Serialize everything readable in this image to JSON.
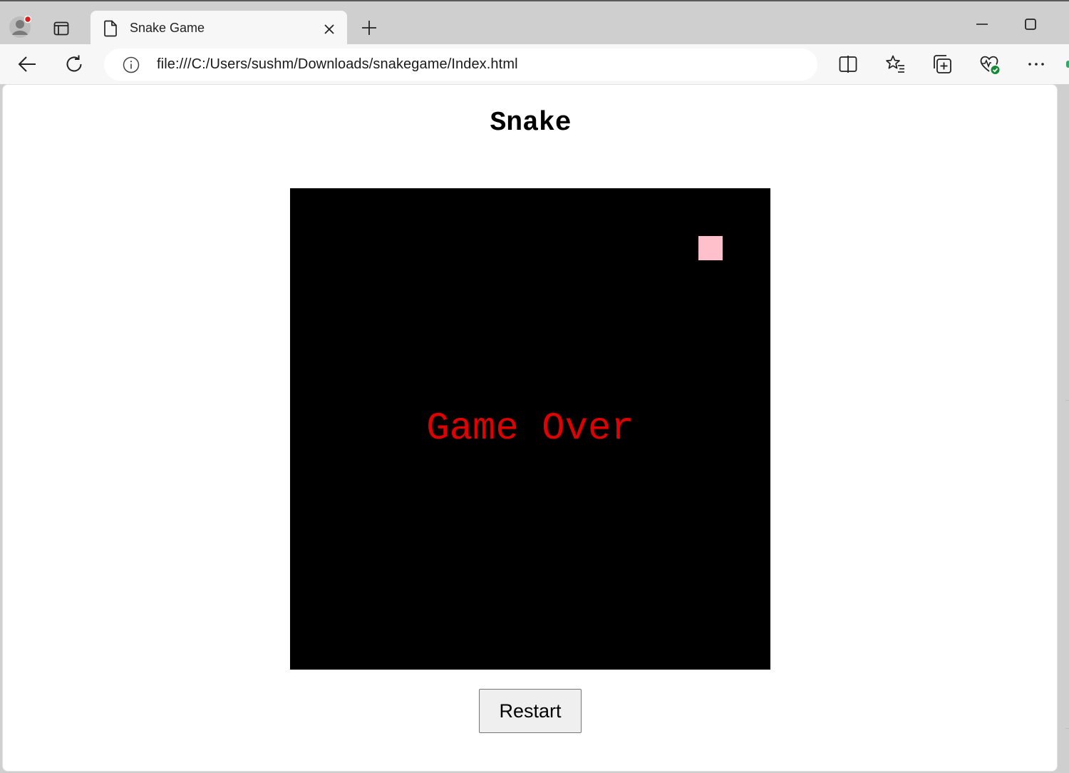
{
  "browser": {
    "tab": {
      "title": "Snake Game"
    },
    "address_bar": {
      "url": "file:///C:/Users/sushm/Downloads/snakegame/Index.html"
    },
    "icons": {
      "profile": "profile-avatar-icon",
      "workspaces": "tab-actions-icon",
      "page": "page-icon",
      "close": "close-icon",
      "new_tab": "plus-icon",
      "minimize": "minimize-icon",
      "maximize": "maximize-icon",
      "back": "back-arrow-icon",
      "refresh": "refresh-icon",
      "info": "info-icon",
      "split_screen": "split-screen-icon",
      "favorites": "favorites-icon",
      "collections": "collections-icon",
      "browser_essentials": "heart-pulse-icon",
      "more": "more-icon"
    }
  },
  "page": {
    "heading": "Snake",
    "game": {
      "status_text": "Game Over",
      "board_color": "#000000",
      "food_color": "#ffc0cb",
      "status_color": "#e00000"
    },
    "restart_label": "Restart"
  }
}
